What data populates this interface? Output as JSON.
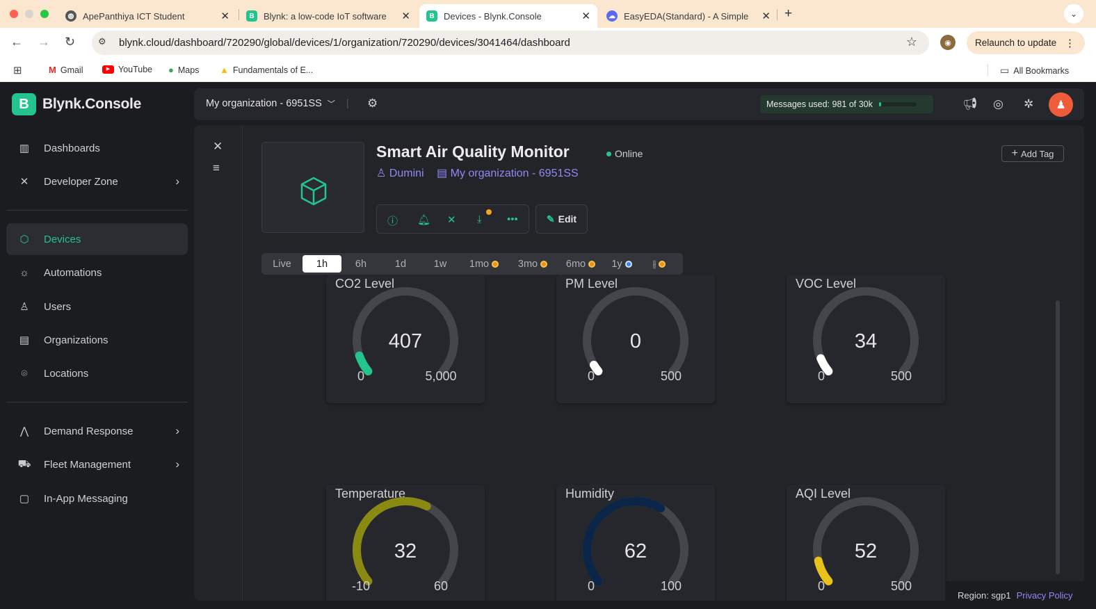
{
  "browser": {
    "tabs": [
      {
        "title": "ApePanthiya ICT Student",
        "favicon": "globe-icon"
      },
      {
        "title": "Blynk: a low-code IoT software",
        "favicon": "blynk-icon"
      },
      {
        "title": "Devices - Blynk.Console",
        "favicon": "blynk-icon",
        "active": true
      },
      {
        "title": "EasyEDA(Standard) - A Simple",
        "favicon": "easyeda-icon"
      }
    ],
    "url": "blynk.cloud/dashboard/720290/global/devices/1/organization/720290/devices/3041464/dashboard",
    "relaunch_label": "Relaunch to update",
    "bookmarks": [
      "Gmail",
      "YouTube",
      "Maps",
      "Fundamentals of E..."
    ],
    "all_bookmarks": "All Bookmarks"
  },
  "app": {
    "brand": "Blynk.Console",
    "logo_letter": "B",
    "accent": "#23c48e",
    "sidebar": {
      "items": [
        {
          "label": "Dashboards",
          "icon": "bar-chart-icon"
        },
        {
          "label": "Developer Zone",
          "icon": "tools-icon"
        },
        {
          "label": "Devices",
          "icon": "cube-icon",
          "active": true
        },
        {
          "label": "Automations",
          "icon": "sun-icon"
        },
        {
          "label": "Users",
          "icon": "users-icon"
        },
        {
          "label": "Organizations",
          "icon": "building-icon"
        },
        {
          "label": "Locations",
          "icon": "map-pin-icon"
        },
        {
          "label": "Demand Response",
          "icon": "chart-icon"
        },
        {
          "label": "Fleet Management",
          "icon": "truck-icon"
        },
        {
          "label": "In-App Messaging",
          "icon": "message-icon"
        }
      ]
    },
    "topbar": {
      "org": "My organization - 6951SS",
      "messages": "Messages used: 981 of 30k",
      "messages_fraction": 0.0327
    }
  },
  "device": {
    "name": "Smart Air Quality Monitor",
    "status": "Online",
    "owner": "Dumini",
    "org": "My organization - 6951SS",
    "edit_label": "Edit",
    "add_tag_label": "Add Tag"
  },
  "timeranges": [
    "Live",
    "1h",
    "6h",
    "1d",
    "1w",
    "1mo",
    "3mo",
    "6mo",
    "1y"
  ],
  "active_range": "1h",
  "gauges": [
    {
      "label": "CO2 Level",
      "value": "407",
      "min": "0",
      "max": "5,000",
      "v": 407,
      "lo": 0,
      "hi": 5000,
      "color": "#23c48e"
    },
    {
      "label": "PM Level",
      "value": "0",
      "min": "0",
      "max": "500",
      "v": 0,
      "lo": 0,
      "hi": 500,
      "color": "#ffffff"
    },
    {
      "label": "VOC Level",
      "value": "34",
      "min": "0",
      "max": "500",
      "v": 34,
      "lo": 0,
      "hi": 500,
      "color": "#ffffff"
    },
    {
      "label": "Temperature",
      "value": "32",
      "min": "-10",
      "max": "60",
      "v": 32,
      "lo": -10,
      "hi": 60,
      "color": "#8a8a12"
    },
    {
      "label": "Humidity",
      "value": "62",
      "min": "0",
      "max": "100",
      "v": 62,
      "lo": 0,
      "hi": 100,
      "color": "#0a2547"
    },
    {
      "label": "AQI Level",
      "value": "52",
      "min": "0",
      "max": "500",
      "v": 52,
      "lo": 0,
      "hi": 500,
      "color": "#e8c21a"
    }
  ],
  "footer": {
    "region": "Region: sgp1",
    "privacy": "Privacy Policy"
  }
}
